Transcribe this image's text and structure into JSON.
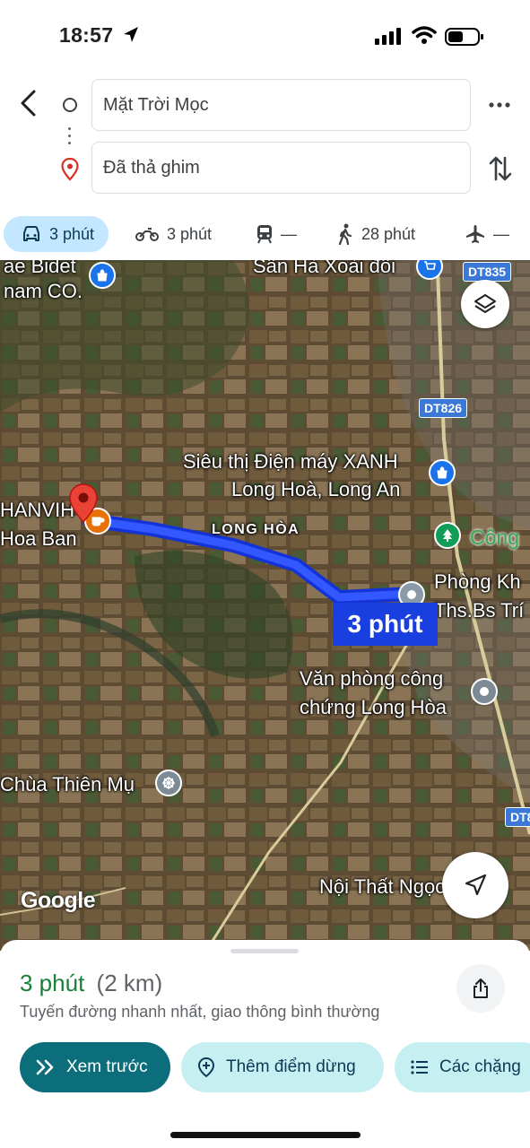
{
  "status_bar": {
    "time": "18:57"
  },
  "search": {
    "origin": "Mặt Trời Mọc",
    "destination": "Đã thả ghim"
  },
  "modes": [
    {
      "icon": "car-icon",
      "label": "3 phút",
      "active": true
    },
    {
      "icon": "motorcycle-icon",
      "label": "3 phút"
    },
    {
      "icon": "transit-icon",
      "label": "—"
    },
    {
      "icon": "walk-icon",
      "label": "28 phút"
    },
    {
      "icon": "flight-icon",
      "label": "—"
    }
  ],
  "map": {
    "labels": {
      "bidet_line1": "ae Bidet",
      "bidet_line2": "nam CO.",
      "san_ha": "Sân Hà Xoài đôi",
      "dt835": "DT835",
      "dt826": "DT826",
      "dt8": "DT8",
      "dmx_line1": "Siêu thị Điện máy XANH",
      "dmx_line2": "Long Hoà, Long An",
      "long_hoa": "LONG HÒA",
      "cong": "Công",
      "hanvi_line1": "HANVIH",
      "hanvi_line2": "Hoa Ban",
      "pk_line1": "Phòng Kh",
      "pk_line2": "Ths.Bs Trí",
      "vp_line1": "Văn phòng công",
      "vp_line2": "chứng Long Hòa",
      "chua": "Chùa Thiên Mụ",
      "noi_that": "Nội Thất Ngọc 2",
      "google": "Google"
    },
    "route_eta": "3 phút"
  },
  "sheet": {
    "duration": "3 phút",
    "distance": "(2 km)",
    "subtitle": "Tuyến đường nhanh nhất, giao thông bình thường",
    "btn_preview": "Xem trước",
    "btn_add_stop": "Thêm điểm dừng",
    "btn_steps": "Các chặng"
  },
  "colors": {
    "route": "#1a3fe0",
    "primary_button": "#0b6e7a",
    "secondary_button": "#c6eff1",
    "active_mode": "#c2e7ff",
    "duration_green": "#188038"
  }
}
